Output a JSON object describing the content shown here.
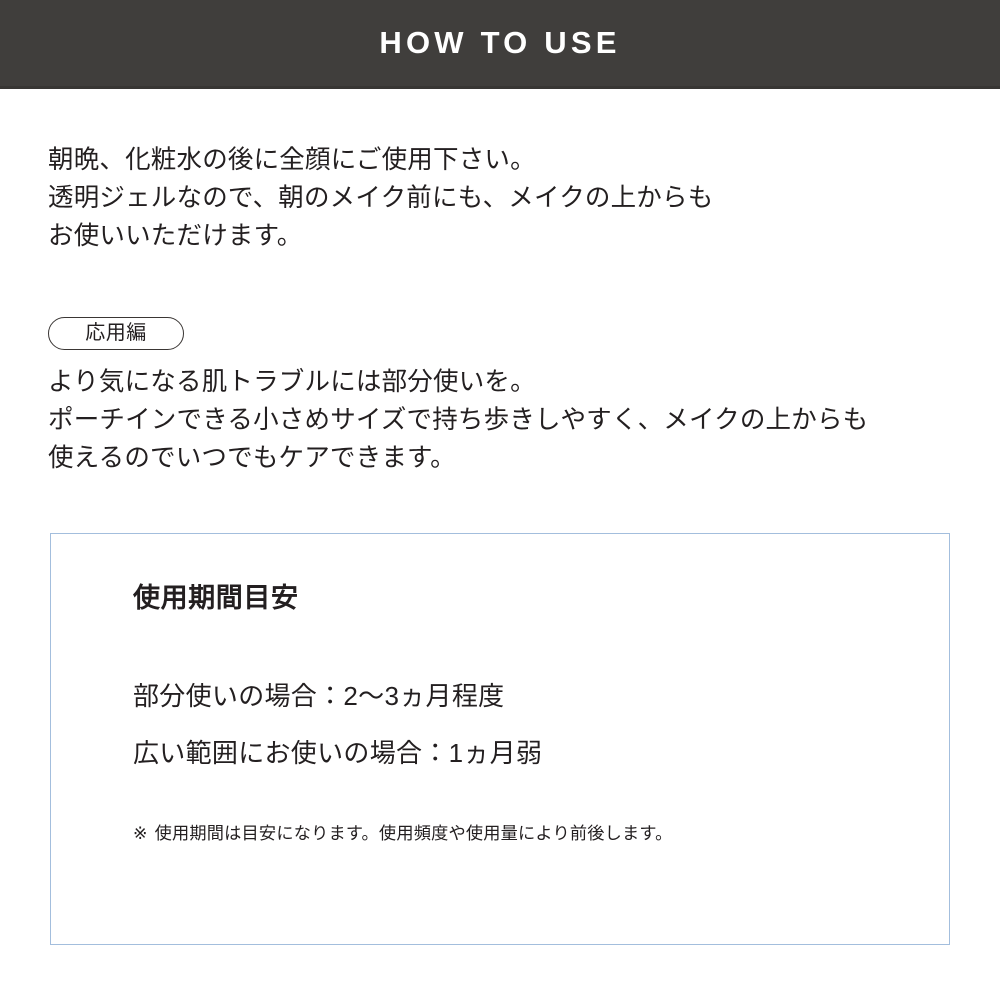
{
  "header": {
    "title": "HOW TO USE",
    "background_color": "#403e3c",
    "text_color": "#ffffff"
  },
  "intro": {
    "line1": "朝晩、化粧水の後に全顔にご使用下さい。",
    "line2": "透明ジェルなので、朝のメイク前にも、メイクの上からも",
    "line3": "お使いいただけます。"
  },
  "badge": {
    "label": "応用編"
  },
  "advanced": {
    "line1": "より気になる肌トラブルには部分使いを。",
    "line2": "ポーチインできる小さめサイズで持ち歩きしやすく、メイクの上からも",
    "line3": "使えるのでいつでもケアできます。"
  },
  "info_box": {
    "heading": "使用期間目安",
    "border_color": "#a3bedd",
    "items": [
      "部分使いの場合：2〜3ヵ月程度",
      "広い範囲にお使いの場合：1ヵ月弱"
    ],
    "note_mark": "※",
    "note_text": "使用期間は目安になります。使用頻度や使用量により前後します。"
  }
}
